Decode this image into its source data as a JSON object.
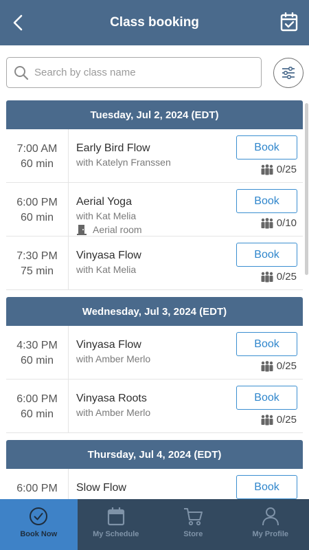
{
  "header": {
    "title": "Class booking",
    "back_icon": "chevron-left-icon",
    "calendar_icon": "calendar-check-icon",
    "bg_color": "#4a6a8c"
  },
  "search": {
    "placeholder": "Search by class name",
    "value": ""
  },
  "days": [
    {
      "header": "Tuesday, Jul 2, 2024 (EDT)",
      "classes": [
        {
          "time": "7:00  AM",
          "duration": "60 min",
          "name": "Early Bird Flow",
          "teacher": "with Katelyn Franssen",
          "room": "",
          "book_label": "Book",
          "capacity": "0/25"
        },
        {
          "time": "6:00  PM",
          "duration": "60 min",
          "name": "Aerial Yoga",
          "teacher": "with Kat Melia",
          "room": "Aerial room",
          "book_label": "Book",
          "capacity": "0/10"
        },
        {
          "time": "7:30  PM",
          "duration": "75 min",
          "name": "Vinyasa Flow",
          "teacher": "with Kat Melia",
          "room": "",
          "book_label": "Book",
          "capacity": "0/25"
        }
      ]
    },
    {
      "header": "Wednesday, Jul 3, 2024 (EDT)",
      "classes": [
        {
          "time": "4:30  PM",
          "duration": "60 min",
          "name": "Vinyasa Flow",
          "teacher": "with Amber Merlo",
          "room": "",
          "book_label": "Book",
          "capacity": "0/25"
        },
        {
          "time": "6:00  PM",
          "duration": "60 min",
          "name": "Vinyasa Roots",
          "teacher": "with Amber Merlo",
          "room": "",
          "book_label": "Book",
          "capacity": "0/25"
        }
      ]
    },
    {
      "header": "Thursday, Jul 4, 2024 (EDT)",
      "classes": [
        {
          "time": "6:00  PM",
          "duration": "",
          "name": "Slow Flow",
          "teacher": "",
          "room": "",
          "book_label": "Book",
          "capacity": ""
        }
      ]
    }
  ],
  "tabbar": {
    "tabs": [
      {
        "label": "Book Now",
        "icon": "check-circle-icon",
        "active": true
      },
      {
        "label": "My Schedule",
        "icon": "calendar-icon",
        "active": false
      },
      {
        "label": "Store",
        "icon": "cart-icon",
        "active": false
      },
      {
        "label": "My Profile",
        "icon": "user-icon",
        "active": false
      }
    ]
  },
  "colors": {
    "accent": "#3e82c7",
    "book_button": "#2f86cc",
    "tabbar_bg": "#33495f",
    "day_header_bg": "#4a6a8c"
  }
}
